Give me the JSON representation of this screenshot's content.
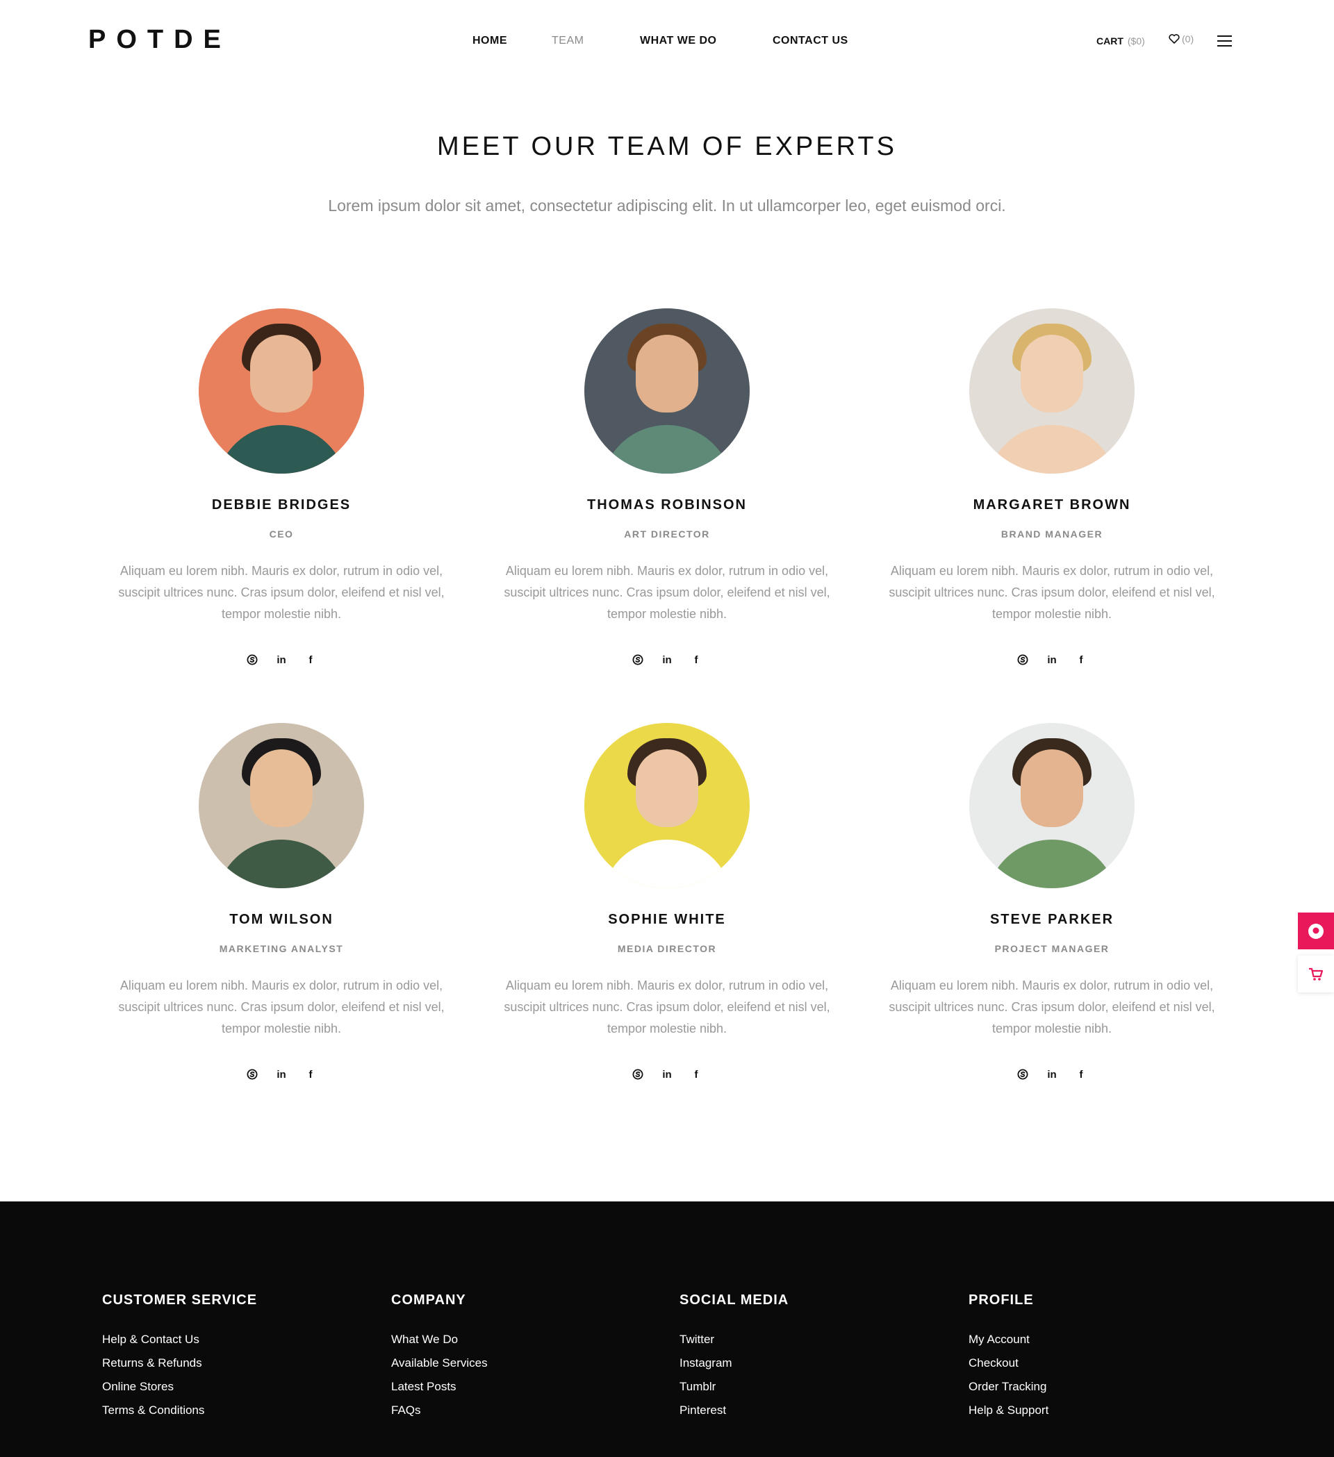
{
  "brand": {
    "logo": "POTDE"
  },
  "nav": {
    "home": "HOME",
    "team": "TEAM",
    "what": "WHAT WE DO",
    "contact": "CONTACT US"
  },
  "header_actions": {
    "cart_label": "CART",
    "cart_amount": "($0)",
    "wishlist_count": "(0)"
  },
  "hero": {
    "title": "MEET OUR TEAM OF EXPERTS",
    "subtitle": "Lorem ipsum dolor sit amet, consectetur adipiscing elit. In ut ullamcorper leo, eget euismod orci."
  },
  "team": [
    {
      "name": "DEBBIE BRIDGES",
      "role": "CEO",
      "bio": "Aliquam eu lorem nibh. Mauris ex dolor, rutrum in odio vel, suscipit ultrices nunc. Cras ipsum dolor, eleifend et nisl vel, tempor molestie nibh.",
      "bg": "#e9805d"
    },
    {
      "name": "THOMAS ROBINSON",
      "role": "ART DIRECTOR",
      "bio": "Aliquam eu lorem nibh. Mauris ex dolor, rutrum in odio vel, suscipit ultrices nunc. Cras ipsum dolor, eleifend et nisl vel, tempor molestie nibh.",
      "bg": "#505861"
    },
    {
      "name": "MARGARET BROWN",
      "role": "BRAND MANAGER",
      "bio": "Aliquam eu lorem nibh. Mauris ex dolor, rutrum in odio vel, suscipit ultrices nunc. Cras ipsum dolor, eleifend et nisl vel, tempor molestie nibh.",
      "bg": "#e2ddd6"
    },
    {
      "name": "TOM WILSON",
      "role": "MARKETING ANALYST",
      "bio": "Aliquam eu lorem nibh. Mauris ex dolor, rutrum in odio vel, suscipit ultrices nunc. Cras ipsum dolor, eleifend et nisl vel, tempor molestie nibh.",
      "bg": "#cdbfae"
    },
    {
      "name": "SOPHIE WHITE",
      "role": "MEDIA DIRECTOR",
      "bio": "Aliquam eu lorem nibh. Mauris ex dolor, rutrum in odio vel, suscipit ultrices nunc. Cras ipsum dolor, eleifend et nisl vel, tempor molestie nibh.",
      "bg": "#ecd94a"
    },
    {
      "name": "STEVE PARKER",
      "role": "PROJECT MANAGER",
      "bio": "Aliquam eu lorem nibh. Mauris ex dolor, rutrum in odio vel, suscipit ultrices nunc. Cras ipsum dolor, eleifend et nisl vel, tempor molestie nibh.",
      "bg": "#e9eaea"
    }
  ],
  "social_icons": [
    "skype-icon",
    "linkedin-icon",
    "facebook-icon"
  ],
  "footer": {
    "customer": {
      "title": "CUSTOMER SERVICE",
      "links": [
        "Help & Contact Us",
        "Returns & Refunds",
        "Online Stores",
        "Terms & Conditions"
      ]
    },
    "company": {
      "title": "COMPANY",
      "links": [
        "What We Do",
        "Available Services",
        "Latest Posts",
        "FAQs"
      ]
    },
    "social": {
      "title": "SOCIAL MEDIA",
      "links": [
        "Twitter",
        "Instagram",
        "Tumblr",
        "Pinterest"
      ]
    },
    "profile": {
      "title": "PROFILE",
      "links": [
        "My Account",
        "Checkout",
        "Order Tracking",
        "Help & Support"
      ]
    }
  },
  "colors": {
    "accent": "#e8185b",
    "footer_bg": "#0a0a0a",
    "muted_text": "#999999"
  }
}
